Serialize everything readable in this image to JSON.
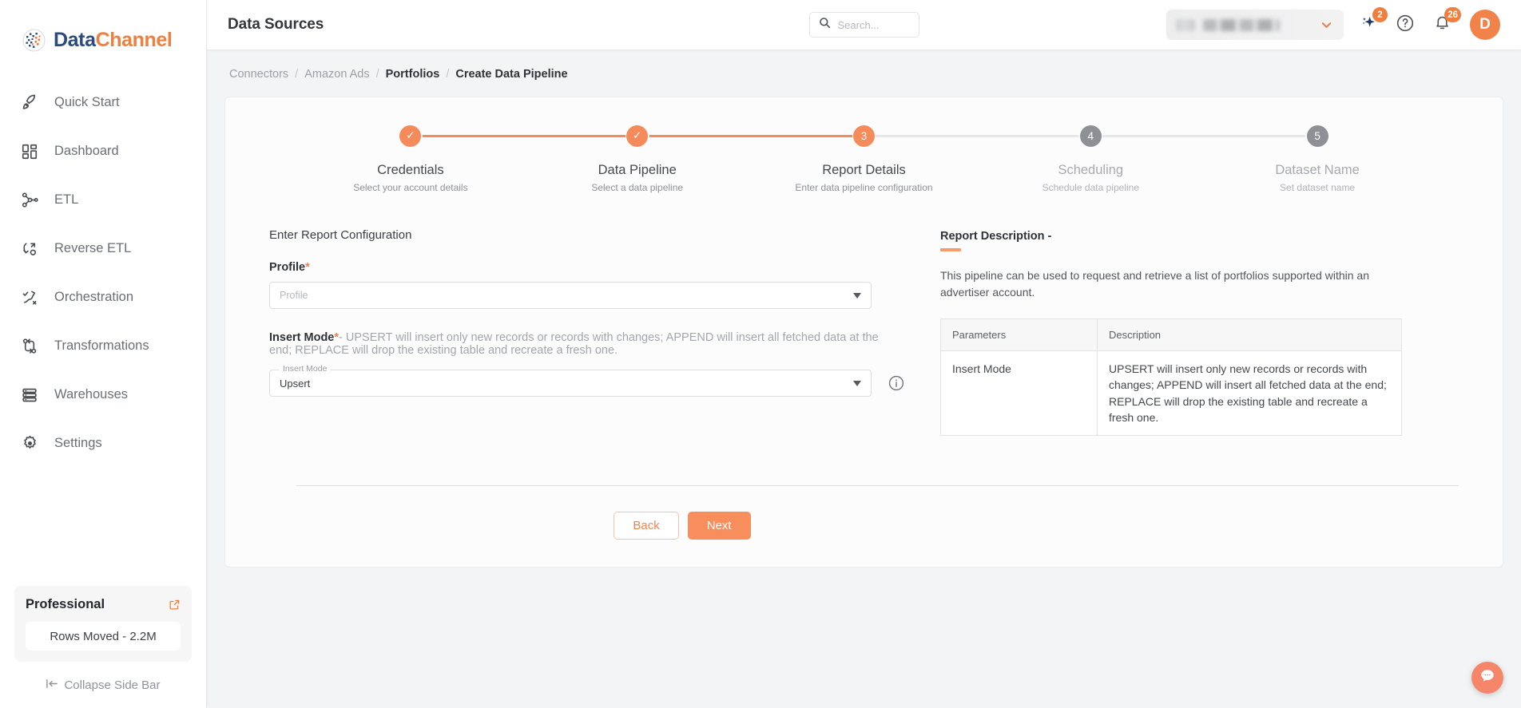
{
  "brand": {
    "part1": "Data",
    "part2": "Channel",
    "logo_icon": "datachannel-logo-icon"
  },
  "sidebar": {
    "items": [
      {
        "label": "Quick Start",
        "icon": "rocket-icon"
      },
      {
        "label": "Dashboard",
        "icon": "grid-icon"
      },
      {
        "label": "ETL",
        "icon": "etl-nodes-icon"
      },
      {
        "label": "Reverse ETL",
        "icon": "reverse-etl-icon"
      },
      {
        "label": "Orchestration",
        "icon": "orchestration-icon"
      },
      {
        "label": "Transformations",
        "icon": "transformations-icon"
      },
      {
        "label": "Warehouses",
        "icon": "database-icon"
      },
      {
        "label": "Settings",
        "icon": "gear-icon"
      }
    ],
    "plan": {
      "name": "Professional",
      "external_link_icon": "external-link-icon",
      "rows_moved": "Rows Moved - 2.2M"
    },
    "collapse_label": "Collapse Side Bar",
    "collapse_icon": "collapse-left-icon"
  },
  "topbar": {
    "title": "Data Sources",
    "search": {
      "placeholder": "Search...",
      "value": "",
      "icon": "search-icon"
    },
    "account_select": {
      "value": "",
      "caret_icon": "chevron-down-icon"
    },
    "ai_icon": "sparkle-icon",
    "ai_badge": "2",
    "help_icon": "help-circle-icon",
    "bell_icon": "bell-icon",
    "bell_badge": "26",
    "avatar_initial": "D"
  },
  "breadcrumb": {
    "items": [
      {
        "label": "Connectors",
        "type": "link"
      },
      {
        "label": "Amazon Ads",
        "type": "link"
      },
      {
        "label": "Portfolios",
        "type": "strong"
      },
      {
        "label": "Create Data Pipeline",
        "type": "current"
      }
    ],
    "separator": "/"
  },
  "stepper": {
    "steps": [
      {
        "num": "1",
        "state": "done",
        "mark": "✓",
        "title": "Credentials",
        "sub": "Select your account details"
      },
      {
        "num": "2",
        "state": "done",
        "mark": "✓",
        "title": "Data Pipeline",
        "sub": "Select a data pipeline"
      },
      {
        "num": "3",
        "state": "active",
        "mark": "3",
        "title": "Report Details",
        "sub": "Enter data pipeline configuration"
      },
      {
        "num": "4",
        "state": "todo",
        "mark": "4",
        "title": "Scheduling",
        "sub": "Schedule data pipeline"
      },
      {
        "num": "5",
        "state": "todo",
        "mark": "5",
        "title": "Dataset Name",
        "sub": "Set dataset name"
      }
    ]
  },
  "form": {
    "section_title": "Enter Report Configuration",
    "profile": {
      "label": "Profile",
      "required_mark": "*",
      "placeholder": "Profile",
      "value": ""
    },
    "insert_mode": {
      "label": "Insert Mode",
      "required_mark": "*",
      "hint": "- UPSERT will insert only new records or records with changes; APPEND will insert all fetched data at the end; REPLACE will drop the existing table and recreate a fresh one.",
      "floating_label": "Insert Mode",
      "value": "Upsert",
      "info_icon": "info-circle-icon"
    },
    "buttons": {
      "back": "Back",
      "next": "Next"
    }
  },
  "report_description": {
    "title": "Report Description -",
    "body": "This pipeline can be used to request and retrieve a list of portfolios supported within an advertiser account.",
    "table": {
      "headers": [
        "Parameters",
        "Description"
      ],
      "rows": [
        {
          "parameter": "Insert Mode",
          "description": "UPSERT will insert only new records or records with changes; APPEND will insert all fetched data at the end; REPLACE will drop the existing table and recreate a fresh one."
        }
      ]
    }
  },
  "chat": {
    "icon": "chat-bubble-icon"
  },
  "colors": {
    "accent": "#f58a5a",
    "accent_strong": "#f07f3f",
    "brand_blue": "#2b4a7d",
    "page_bg": "#f3f4f6",
    "step_todo": "#8e9095"
  }
}
